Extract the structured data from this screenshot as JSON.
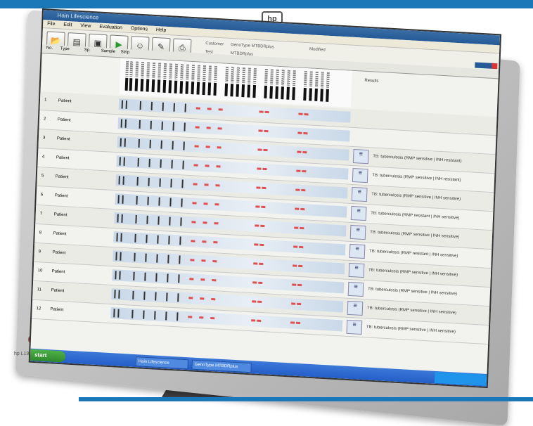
{
  "window": {
    "title": "Hain Lifescience"
  },
  "menu": [
    "File",
    "Edit",
    "View",
    "Evaluation",
    "Options",
    "Help"
  ],
  "toolbar": {
    "buttons": [
      "open-icon",
      "new-icon",
      "save-icon",
      "play-icon",
      "people-icon",
      "report-icon",
      "print-icon"
    ],
    "fields": [
      {
        "label": "Customer",
        "value": "GenoType MTBDRplus"
      },
      {
        "label": "Test",
        "value": "MTBDRplus"
      },
      {
        "label": "Modified",
        "value": ""
      }
    ]
  },
  "columns": {
    "no": "No.",
    "type": "Type",
    "sp": "Sp.",
    "sample": "Sample",
    "strip": "Strip",
    "results": "Results"
  },
  "rows": [
    {
      "no": "1",
      "type": "Patient",
      "sp": "",
      "result": ""
    },
    {
      "no": "2",
      "type": "Patient",
      "sp": "",
      "result": ""
    },
    {
      "no": "3",
      "type": "Patient",
      "sp": "",
      "result": "TB: tuberculosis (RMP sensitive | INH resistant)"
    },
    {
      "no": "4",
      "type": "Patient",
      "sp": "",
      "result": "TB: tuberculosis (RMP sensitive | INH resistant)"
    },
    {
      "no": "5",
      "type": "Patient",
      "sp": "",
      "result": "TB: tuberculosis (RMP sensitive | INH sensitive)"
    },
    {
      "no": "6",
      "type": "Patient",
      "sp": "",
      "result": "TB: tuberculosis (RMP resistant | INH sensitive)"
    },
    {
      "no": "7",
      "type": "Patient",
      "sp": "",
      "result": "TB: tuberculosis (RMP sensitive | INH sensitive)"
    },
    {
      "no": "8",
      "type": "Patient",
      "sp": "",
      "result": "TB: tuberculosis (RMP resistant | INH sensitive)"
    },
    {
      "no": "9",
      "type": "Patient",
      "sp": "",
      "result": "TB: tuberculosis (RMP sensitive | INH sensitive)"
    },
    {
      "no": "10",
      "type": "Patient",
      "sp": "",
      "result": "TB: tuberculosis (RMP sensitive | INH sensitive)"
    },
    {
      "no": "11",
      "type": "Patient",
      "sp": "",
      "result": "TB: tuberculosis (RMP sensitive | INH sensitive)"
    },
    {
      "no": "12",
      "type": "Patient",
      "sp": "",
      "result": "TB: tuberculosis (RMP sensitive | INH sensitive)"
    }
  ],
  "taskbar": {
    "start": "start",
    "tasks": [
      "Hain Lifescience",
      "GenoType MTBDRplus"
    ],
    "tray": ""
  },
  "monitor": {
    "logo": "hp",
    "brand": "hp L1906"
  },
  "colors": {
    "accent": "#1a78b8",
    "title_bar": "#245a96",
    "positive_band": "#e05050"
  }
}
